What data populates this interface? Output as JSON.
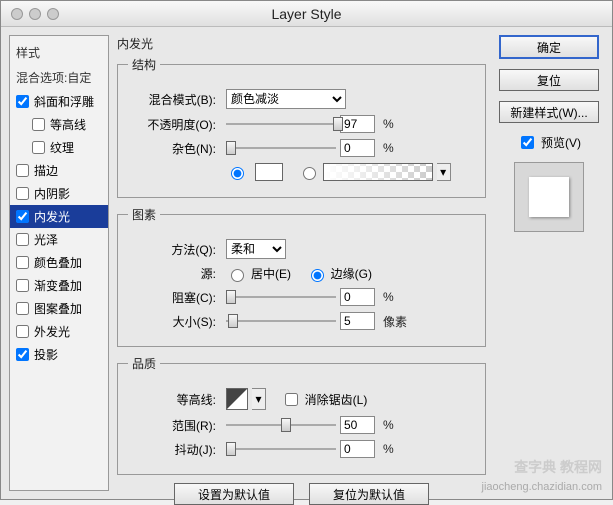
{
  "window": {
    "title": "Layer Style"
  },
  "left": {
    "header1": "样式",
    "header2": "混合选项:自定",
    "items": [
      {
        "label": "斜面和浮雕",
        "checked": true,
        "indent": 0
      },
      {
        "label": "等高线",
        "checked": false,
        "indent": 1
      },
      {
        "label": "纹理",
        "checked": false,
        "indent": 1
      },
      {
        "label": "描边",
        "checked": false,
        "indent": 0
      },
      {
        "label": "内阴影",
        "checked": false,
        "indent": 0
      },
      {
        "label": "内发光",
        "checked": true,
        "indent": 0,
        "selected": true
      },
      {
        "label": "光泽",
        "checked": false,
        "indent": 0
      },
      {
        "label": "颜色叠加",
        "checked": false,
        "indent": 0
      },
      {
        "label": "渐变叠加",
        "checked": false,
        "indent": 0
      },
      {
        "label": "图案叠加",
        "checked": false,
        "indent": 0
      },
      {
        "label": "外发光",
        "checked": false,
        "indent": 0
      },
      {
        "label": "投影",
        "checked": true,
        "indent": 0
      }
    ]
  },
  "middle": {
    "title": "内发光",
    "structure": {
      "legend": "结构",
      "blendModeLabel": "混合模式(B):",
      "blendModeValue": "颜色减淡",
      "opacityLabel": "不透明度(O):",
      "opacityValue": "97",
      "opacityUnit": "%",
      "noiseLabel": "杂色(N):",
      "noiseValue": "0",
      "noiseUnit": "%"
    },
    "elements": {
      "legend": "图素",
      "techniqueLabel": "方法(Q):",
      "techniqueValue": "柔和",
      "sourceLabel": "源:",
      "centerLabel": "居中(E)",
      "edgeLabel": "边缘(G)",
      "chokeLabel": "阻塞(C):",
      "chokeValue": "0",
      "chokeUnit": "%",
      "sizeLabel": "大小(S):",
      "sizeValue": "5",
      "sizeUnit": "像素"
    },
    "quality": {
      "legend": "品质",
      "contourLabel": "等高线:",
      "antialiasLabel": "消除锯齿(L)",
      "rangeLabel": "范围(R):",
      "rangeValue": "50",
      "rangeUnit": "%",
      "jitterLabel": "抖动(J):",
      "jitterValue": "0",
      "jitterUnit": "%"
    },
    "setDefault": "设置为默认值",
    "resetDefault": "复位为默认值"
  },
  "right": {
    "ok": "确定",
    "cancel": "复位",
    "newStyle": "新建样式(W)...",
    "preview": "预览(V)"
  },
  "watermark1": "查字典 教程网",
  "watermark2": "jiaocheng.chazidian.com"
}
